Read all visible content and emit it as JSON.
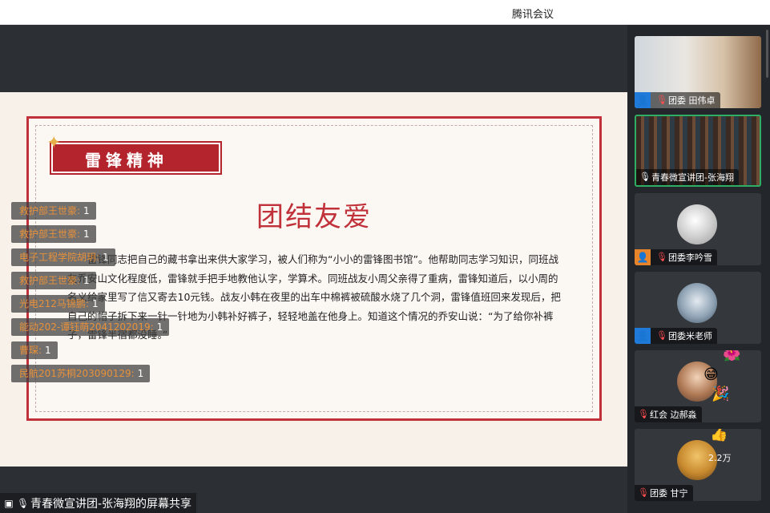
{
  "app": {
    "title": "腾讯会议"
  },
  "slide": {
    "banner": "雷锋精神",
    "title": "团结友爱",
    "body": "雷锋同志把自己的藏书拿出来供大家学习，被人们称为“小小的雷锋图书馆”。他帮助同志学习知识，同班战友乔安山文化程度低，雷锋就手把手地教他认字，学算术。同班战友小周父亲得了重病，雷锋知道后，以小周的名义给家里写了信又寄去10元钱。战友小韩在夜里的出车中棉裤被硫酸水烧了几个洞，雷锋值班回来发现后，把自己的帽子拆下来一针一针地为小韩补好裤子，轻轻地盖在他身上。知道这个情况的乔安山说：“为了给你补裤子，雷锋半宿都没睡。”"
  },
  "comments": [
    {
      "name": "救护部王世豪:",
      "count": "1"
    },
    {
      "name": "救护部王世豪:",
      "count": "1"
    },
    {
      "name": "电子工程学院胡玥:",
      "count": "1"
    },
    {
      "name": "救护部王世豪:",
      "count": "1"
    },
    {
      "name": "光电212马锦鹏:",
      "count": "1"
    },
    {
      "name": "能动202-谭钰萌2041202019:",
      "count": "1"
    },
    {
      "name": "曹琛:",
      "count": "1"
    },
    {
      "name": "民航201苏桐203090129:",
      "count": "1"
    }
  ],
  "share_label": "青春微宣讲团-张海翔的屏幕共享",
  "participants": [
    {
      "name": "团委 田伟卓",
      "badge": "user-icon",
      "mic": "muted"
    },
    {
      "name": "青春微宣讲团-张海翔",
      "badge": "",
      "mic": "on"
    },
    {
      "name": "团委李吟雪",
      "badge": "user-icon",
      "mic": "muted"
    },
    {
      "name": "团委米老师",
      "badge": "user-icon",
      "mic": "muted"
    },
    {
      "name": "红会 边郝淼",
      "badge": "",
      "mic": "muted"
    },
    {
      "name": "团委 甘宁",
      "badge": "",
      "mic": "muted",
      "overlay": "2.2万"
    }
  ],
  "colors": {
    "accent": "#c0313a",
    "comment_name": "#e8913a",
    "active_tile": "#2dae63"
  }
}
